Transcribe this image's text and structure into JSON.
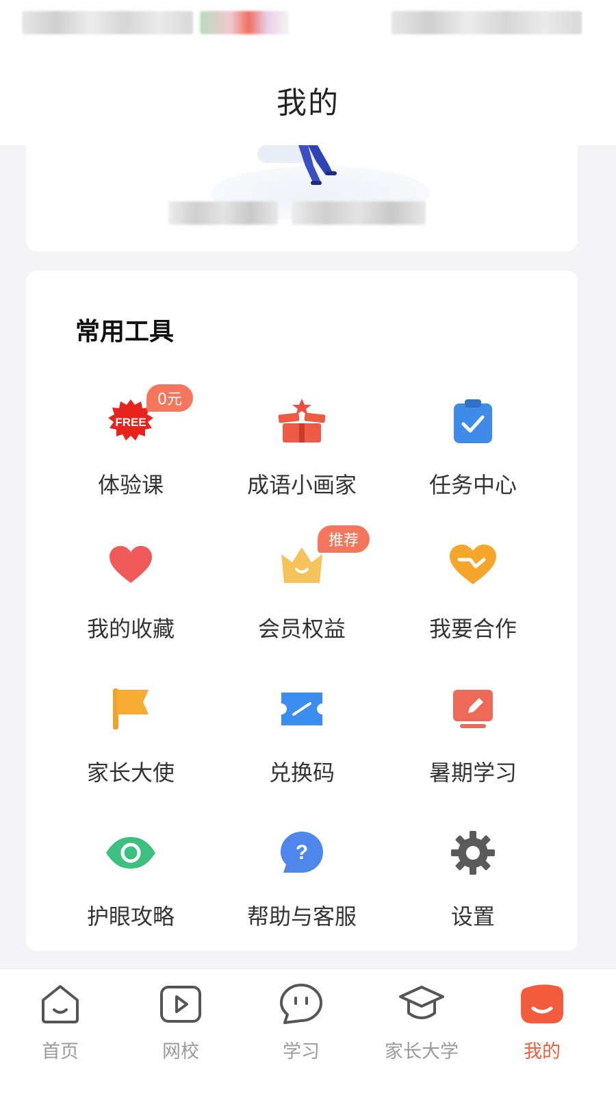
{
  "page": {
    "title": "我的"
  },
  "tools": {
    "heading": "常用工具",
    "items": [
      {
        "label": "体验课",
        "icon": "free-badge-icon",
        "badge": "0元"
      },
      {
        "label": "成语小画家",
        "icon": "gift-icon",
        "badge": ""
      },
      {
        "label": "任务中心",
        "icon": "clipboard-check-icon",
        "badge": ""
      },
      {
        "label": "我的收藏",
        "icon": "heart-icon",
        "badge": ""
      },
      {
        "label": "会员权益",
        "icon": "crown-icon",
        "badge": "推荐"
      },
      {
        "label": "我要合作",
        "icon": "handshake-heart-icon",
        "badge": ""
      },
      {
        "label": "家长大使",
        "icon": "flag-icon",
        "badge": ""
      },
      {
        "label": "兑换码",
        "icon": "ticket-icon",
        "badge": ""
      },
      {
        "label": "暑期学习",
        "icon": "edit-board-icon",
        "badge": ""
      },
      {
        "label": "护眼攻略",
        "icon": "eye-icon",
        "badge": ""
      },
      {
        "label": "帮助与客服",
        "icon": "help-bubble-icon",
        "badge": ""
      },
      {
        "label": "设置",
        "icon": "gear-icon",
        "badge": ""
      }
    ]
  },
  "tabbar": {
    "items": [
      {
        "label": "首页",
        "icon": "home-icon",
        "active": false
      },
      {
        "label": "网校",
        "icon": "play-screen-icon",
        "active": false
      },
      {
        "label": "学习",
        "icon": "face-bubble-icon",
        "active": false
      },
      {
        "label": "家长大学",
        "icon": "graduation-cap-icon",
        "active": false
      },
      {
        "label": "我的",
        "icon": "profile-face-icon",
        "active": true
      }
    ]
  },
  "colors": {
    "accent": "#f25b3b",
    "badge": "#f4765c",
    "inactive_tab": "#9a9a9a",
    "page_bg": "#f4f4f6"
  }
}
